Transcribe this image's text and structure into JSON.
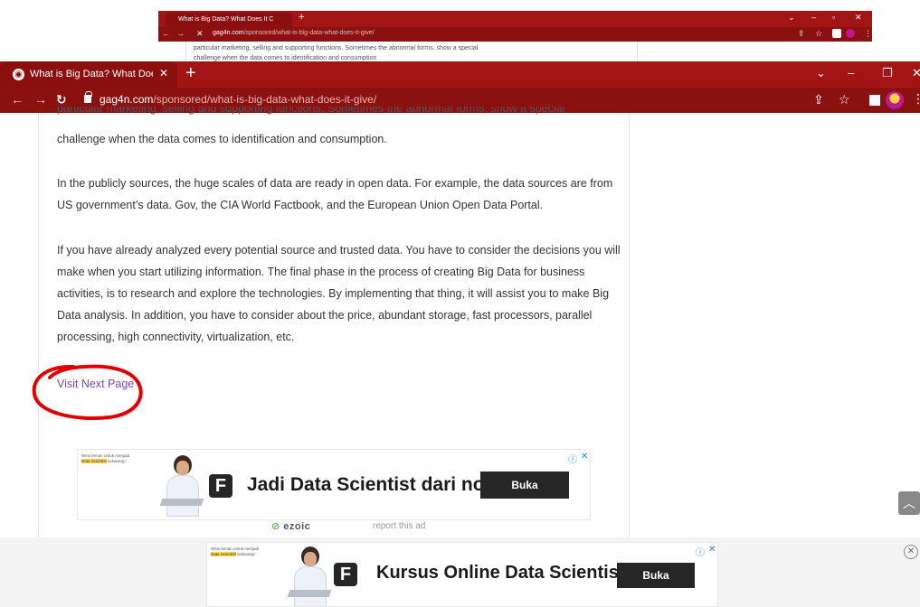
{
  "ghost": {
    "tab_title": "What is Big Data? What Does It C",
    "url_domain": "gag4n.com",
    "url_path": "/sponsored/what-is-big-data-what-does-it-give/",
    "page_line1": "particular marketing, selling and supporting functions. Sometimes the abnormal forms, show a special",
    "page_line2": "challenge when the data comes to identification and consumption"
  },
  "browser": {
    "tab_title": "What is Big Data? What Does It C",
    "url_domain": "gag4n.com",
    "url_path": "/sponsored/what-is-big-data-what-does-it-give/",
    "accent": "#a31515"
  },
  "article": {
    "cut_line": "particular marketing, selling and supporting functions. Sometimes the abnormal forms, show a special",
    "p1": "challenge when the data comes to identification and consumption.",
    "p2": "In the publicly sources, the huge scales of data are ready in open data. For example, the data sources are from US government’s data. Gov, the CIA World Factbook, and the European Union Open Data Portal.",
    "p3": "If you have already analyzed every potential source and trusted data. You have to consider the decisions you will make when you start utilizing information. The final phase in the process of creating Big Data for business activities, is to research and explore the technologies. By implementing that thing, it will assist you to make Big Data analysis. In addition, you have to consider about the price, abundant storage, fast processors, parallel processing, high connectivity, virtualization, etc.",
    "next_link": "Visit Next Page"
  },
  "ad1": {
    "headline": "Jadi Data Scientist dari nol",
    "button": "Buka",
    "logo": "F",
    "small_title": "Wèis teman untuk menjadi",
    "small_highlight": "Data Scientist",
    "small_suffix": "sekarang!"
  },
  "ad2": {
    "headline": "Kursus Online Data Scientist",
    "button": "Buka",
    "logo": "F"
  },
  "ezoic": {
    "brand": "ezoic",
    "report": "report this ad"
  }
}
